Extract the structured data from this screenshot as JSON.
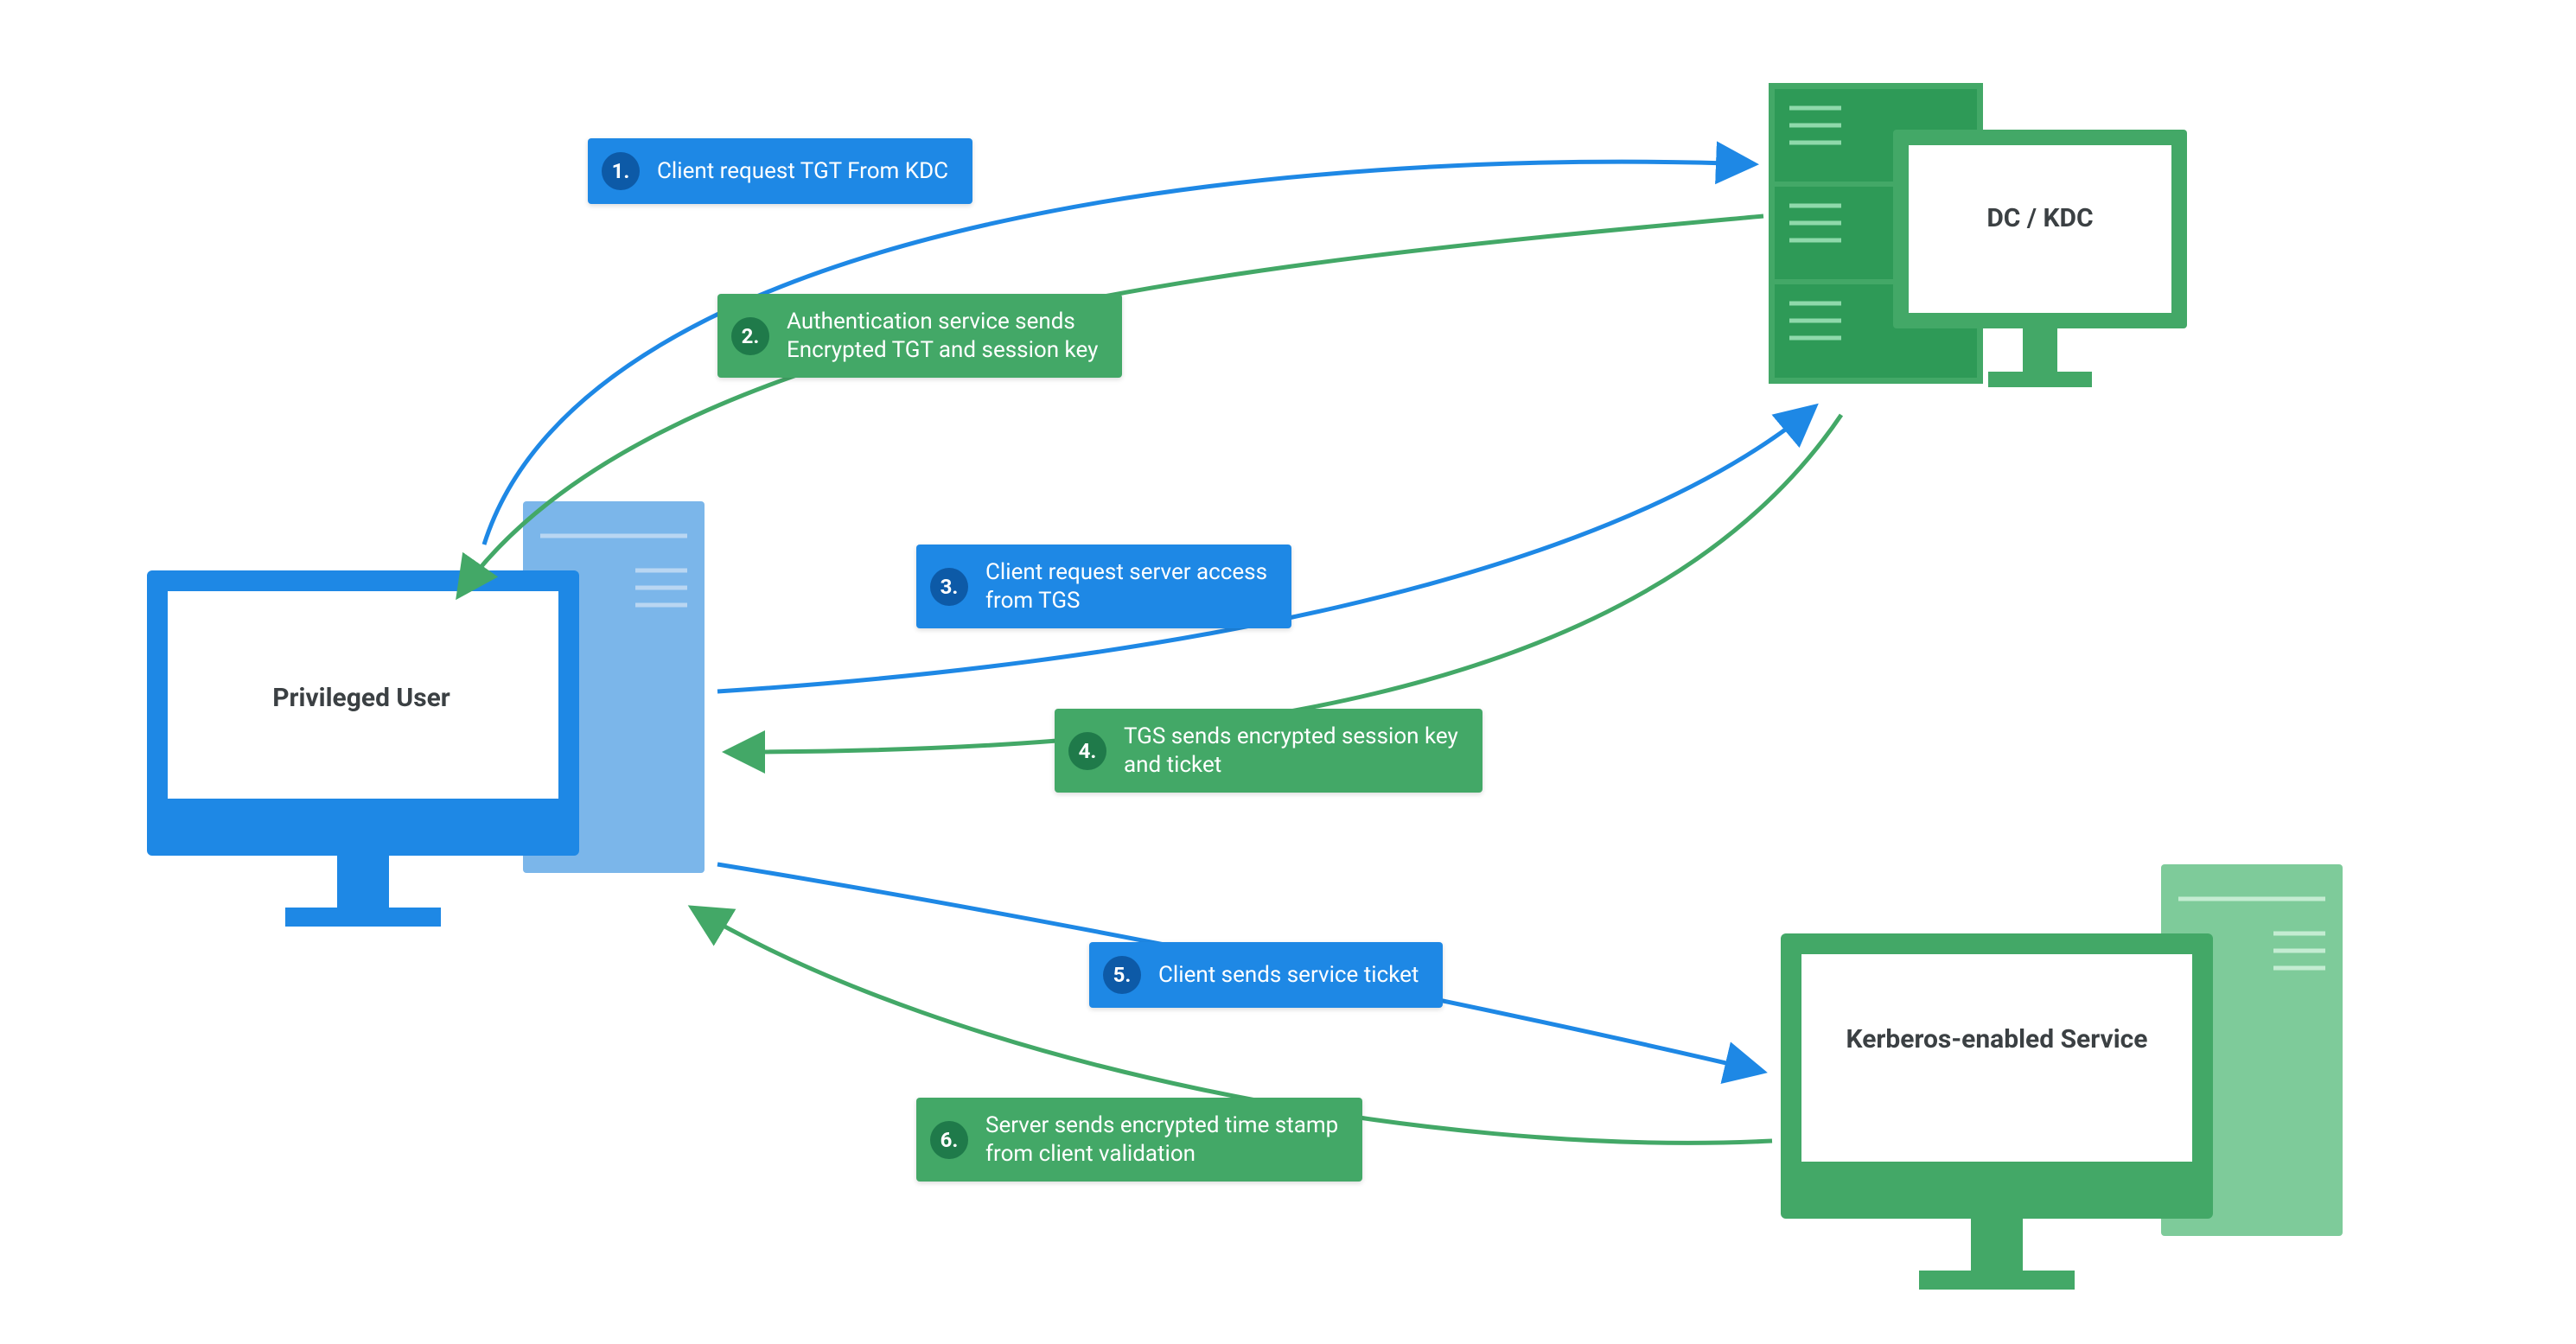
{
  "colors": {
    "blue": "#1e88e5",
    "blue_dark": "#1565c0",
    "green": "#43a867",
    "green_dark": "#2e7d32",
    "text": "#3b4043",
    "bg": "#ffffff"
  },
  "nodes": {
    "user": {
      "label": "Privileged User"
    },
    "kdc": {
      "label": "DC / KDC"
    },
    "service": {
      "label": "Kerberos-enabled\nService"
    }
  },
  "steps": [
    {
      "num": "1.",
      "color": "blue",
      "text": "Client request TGT From KDC"
    },
    {
      "num": "2.",
      "color": "green",
      "text": "Authentication service sends\nEncrypted TGT and session key"
    },
    {
      "num": "3.",
      "color": "blue",
      "text": "Client request server access\nfrom TGS"
    },
    {
      "num": "4.",
      "color": "green",
      "text": "TGS sends encrypted session key\nand ticket"
    },
    {
      "num": "5.",
      "color": "blue",
      "text": "Client sends service ticket"
    },
    {
      "num": "6.",
      "color": "green",
      "text": "Server sends encrypted time stamp\nfrom client validation"
    }
  ]
}
